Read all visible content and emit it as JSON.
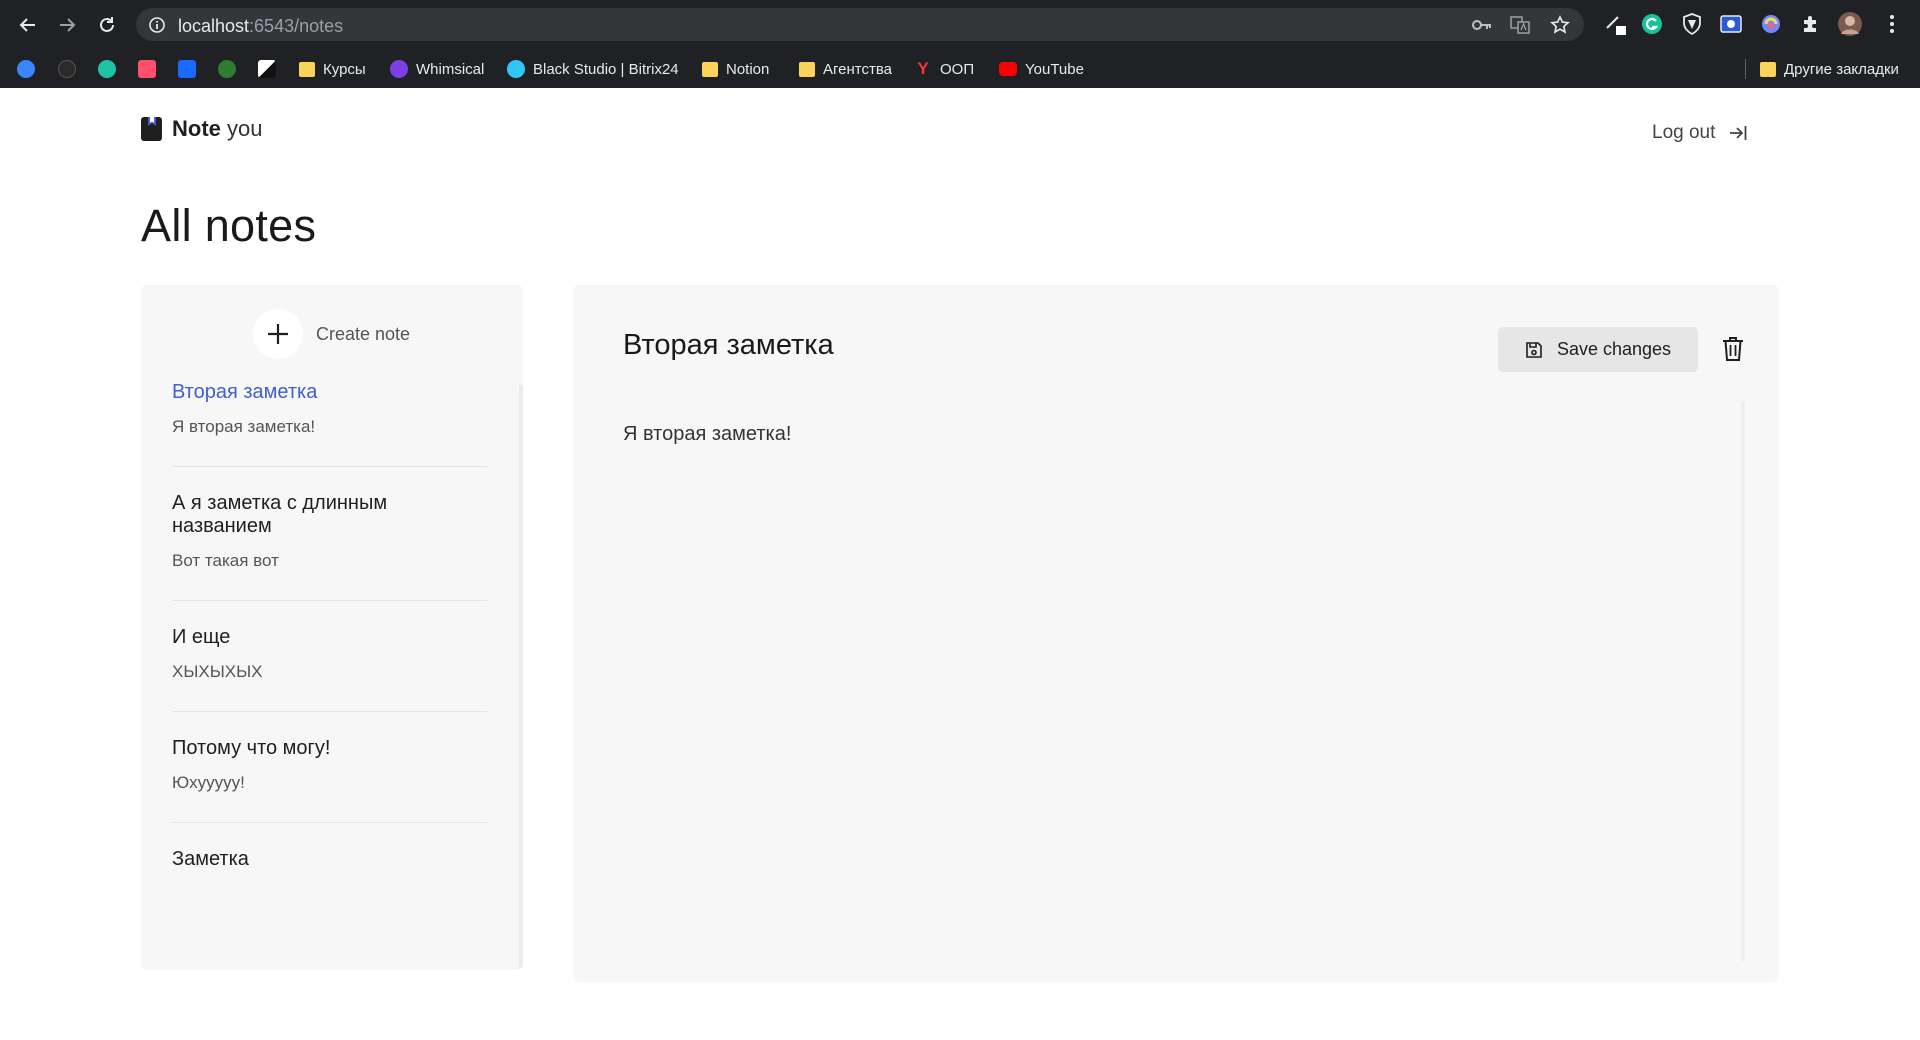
{
  "browser": {
    "url_host": "localhost",
    "url_path": ":6543/notes",
    "bookmarks": [
      {
        "label": "Курсы",
        "kind": "folder"
      },
      {
        "label": "Whimsical",
        "kind": "site",
        "color": "#7b3fe4"
      },
      {
        "label": "Black Studio | Bitrix24",
        "kind": "site",
        "color": "#2fc7f7"
      },
      {
        "label": "Notion",
        "kind": "folder"
      },
      {
        "label": "Агентства",
        "kind": "folder"
      },
      {
        "label": "ООП",
        "kind": "site",
        "color": "#ff3333"
      },
      {
        "label": "YouTube",
        "kind": "site",
        "color": "#ff0000"
      }
    ],
    "other_bookmarks": "Другие закладки"
  },
  "app": {
    "logo_bold": "Note",
    "logo_light": "you",
    "logout_label": "Log out",
    "page_title": "All notes",
    "accent": "#3f5fd0"
  },
  "sidebar": {
    "create_label": "Create note",
    "notes": [
      {
        "title": "Вторая заметка",
        "preview": "Я вторая заметка!",
        "active": true
      },
      {
        "title": "А я заметка с длинным названием",
        "preview": "Вот такая вот",
        "active": false
      },
      {
        "title": "И еще",
        "preview": "ХЫХЫХЫХ",
        "active": false
      },
      {
        "title": "Потому что могу!",
        "preview": "Юхууууу!",
        "active": false
      },
      {
        "title": "Заметка",
        "preview": "",
        "active": false
      }
    ]
  },
  "editor": {
    "title": "Вторая заметка",
    "save_label": "Save changes",
    "body": "Я вторая заметка!"
  }
}
